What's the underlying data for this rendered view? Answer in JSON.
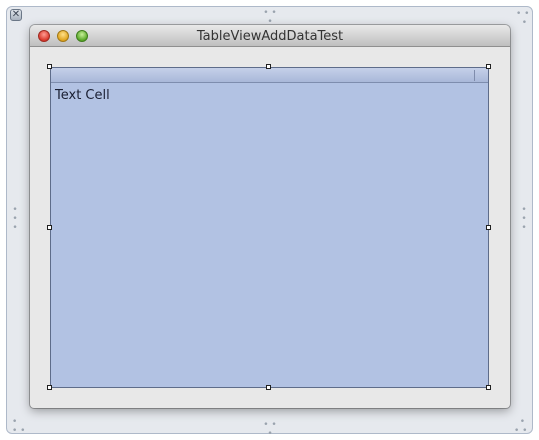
{
  "editor": {
    "close_glyph": "✕"
  },
  "window": {
    "title": "TableViewAddDataTest"
  },
  "table_view": {
    "cell_text": "Text Cell"
  },
  "colors": {
    "table_background": "#b2c2e3",
    "window_background": "#e8e8e8",
    "frame_background": "#e6e9ee"
  },
  "icons": [
    "editor-close-icon",
    "window-close-icon",
    "window-minimize-icon",
    "window-zoom-icon",
    "resize-grip-icon",
    "selection-handle-icon"
  ]
}
